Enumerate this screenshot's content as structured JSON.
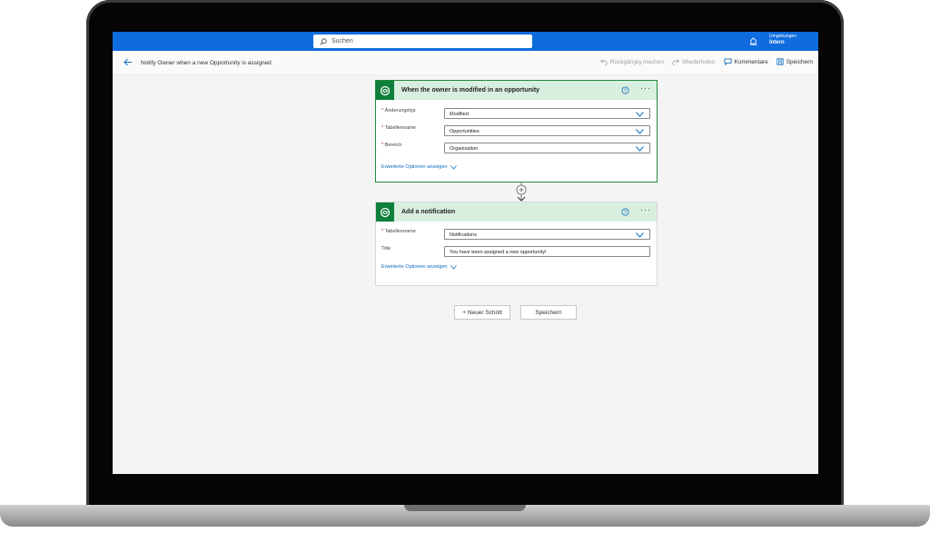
{
  "topbar": {
    "search_placeholder": "Suchen",
    "env_label": "Umgebungen",
    "env_value": "Intern"
  },
  "cmdbar": {
    "flow_title": "Notify Owner when a new Opportunity is assigned",
    "undo": "Rückgängig machen",
    "redo": "Wiederholen",
    "comments": "Kommentare",
    "save": "Speichern"
  },
  "trigger": {
    "title": "When the owner is modified in an opportunity",
    "fields": [
      {
        "label": "Änderungstyp",
        "required": true,
        "value": "Modified"
      },
      {
        "label": "Tabellenname",
        "required": true,
        "value": "Opportunities"
      },
      {
        "label": "Bereich",
        "required": true,
        "value": "Organization"
      }
    ],
    "advanced": "Erweiterte Optionen anzeigen"
  },
  "action": {
    "title": "Add a notification",
    "fields": [
      {
        "label": "Tabellenname",
        "required": true,
        "value": "Notifications"
      },
      {
        "label": "Title",
        "required": false,
        "value": "You have been assigned a new opportunity!"
      }
    ],
    "advanced": "Erweiterte Optionen anzeigen"
  },
  "footer": {
    "new_step": "+ Neuer Schritt",
    "save": "Speichern"
  },
  "colors": {
    "accent": "#0f6cde",
    "connector_green": "#0f7f3b",
    "card_header": "#d8efe0"
  }
}
